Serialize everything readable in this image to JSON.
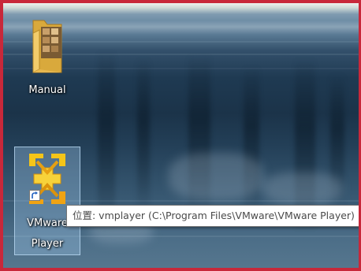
{
  "desktop": {
    "icons": [
      {
        "label": "Manual",
        "type": "folder"
      },
      {
        "label_line1": "VMware",
        "label_line2": "Player",
        "type": "application-shortcut",
        "selected": true
      }
    ],
    "tooltip": {
      "text": "位置: vmplayer (C:\\Program Files\\VMware\\VMware Player)"
    }
  },
  "colors": {
    "frame_border": "#c8283a",
    "selection_fill": "#a0c8eb",
    "tooltip_bg": "#ffffff",
    "tooltip_text": "#4a4a4a",
    "icon_label_text": "#ffffff"
  },
  "icons": {
    "folder": "folder-icon",
    "vmware": "vmware-player-icon",
    "shortcut_overlay": "shortcut-arrow-icon"
  }
}
